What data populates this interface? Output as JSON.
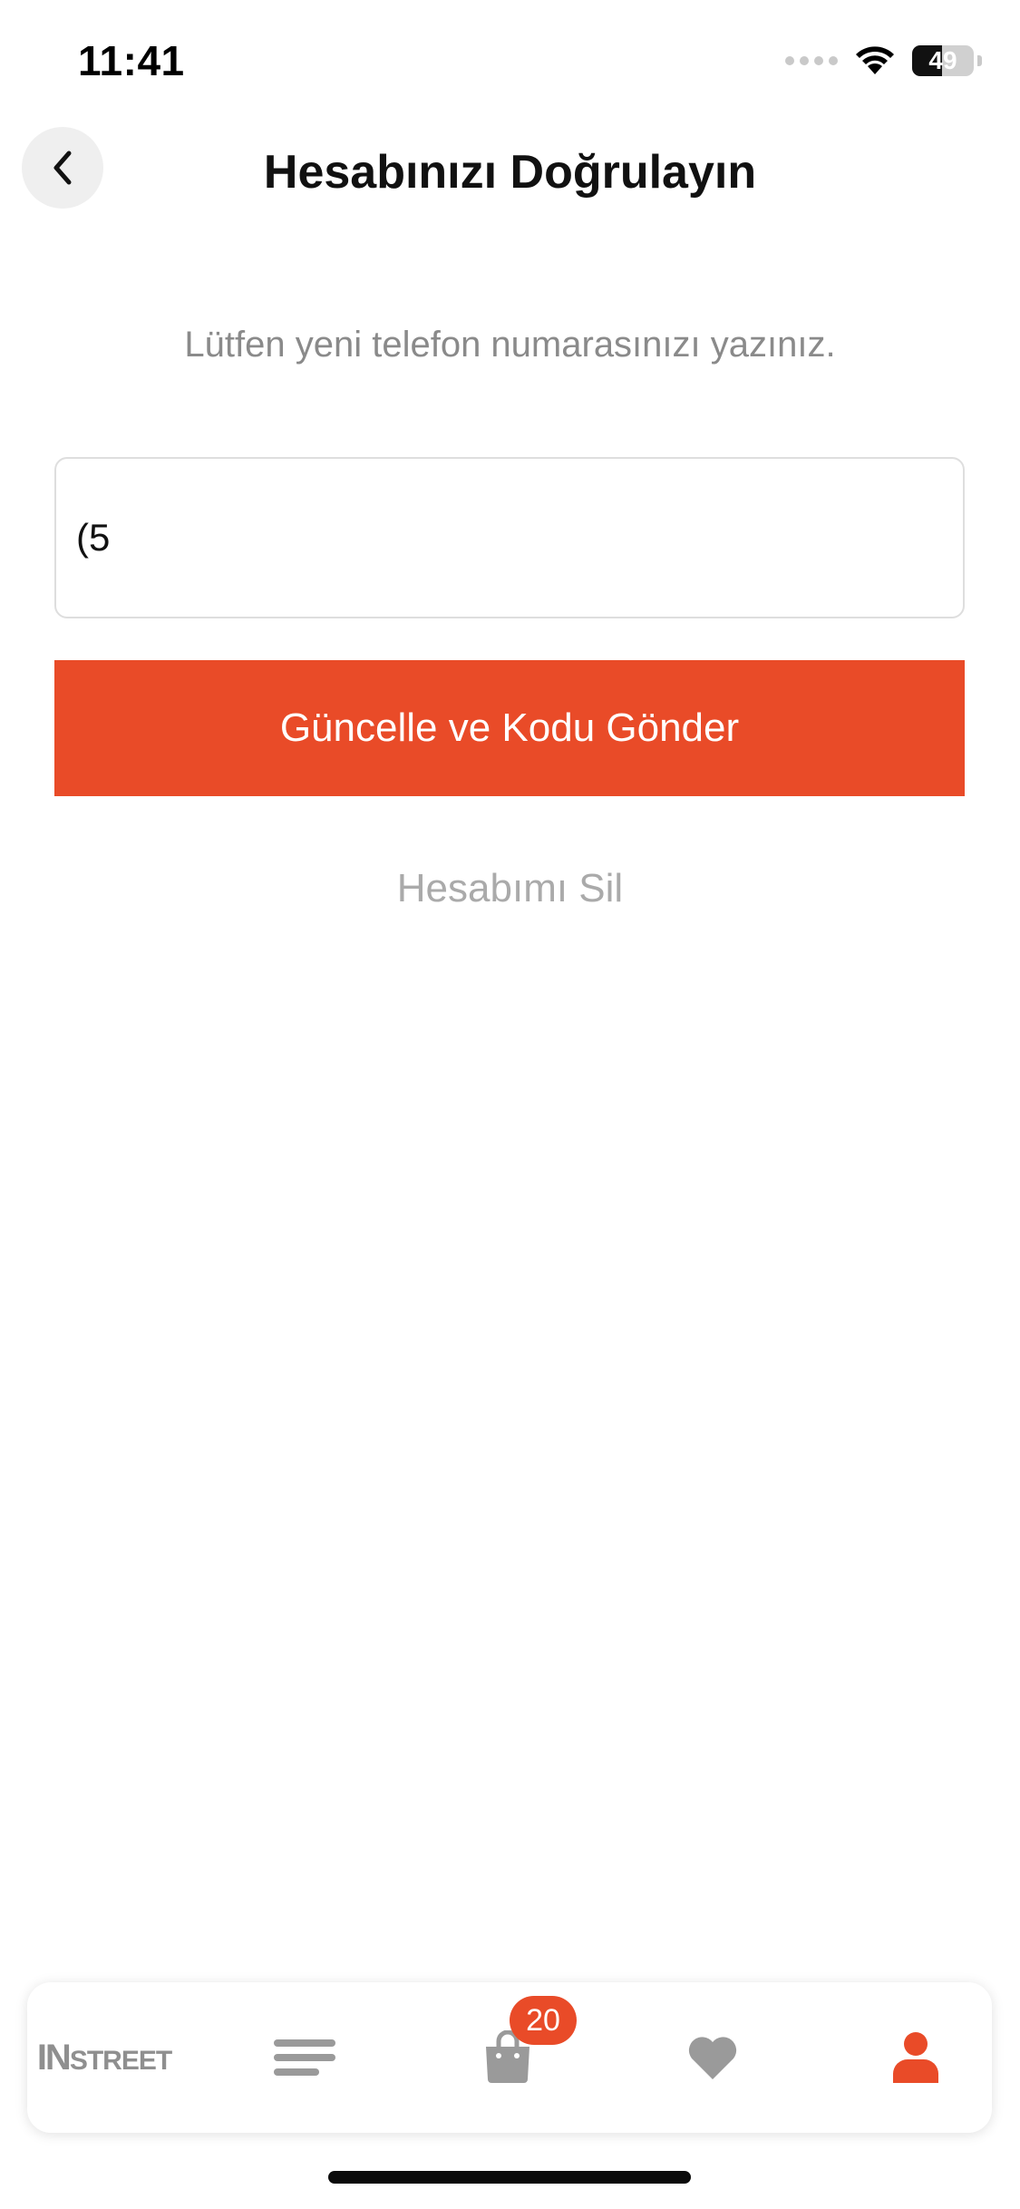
{
  "status_bar": {
    "time": "11:41",
    "battery_level": "49",
    "battery_fraction": 0.49
  },
  "header": {
    "title": "Hesabınızı Doğrulayın",
    "back_icon": "chevron-left-icon"
  },
  "form": {
    "instruction": "Lütfen yeni telefon numarasınızı yazınız.",
    "phone_value": "(5",
    "submit_label": "Güncelle ve Kodu Gönder",
    "delete_label": "Hesabımı Sil"
  },
  "tab_bar": {
    "home_logo_prefix": "IN",
    "home_logo_suffix": "STREET",
    "cart_badge": "20",
    "icons": [
      "instreet-logo",
      "menu-icon",
      "shopping-bag-icon",
      "heart-icon",
      "user-icon"
    ]
  },
  "colors": {
    "accent": "#e94b28",
    "inactive_icon": "#9a9a9a",
    "muted_text": "#8a8a8a",
    "delete_text": "#aaaaaa"
  }
}
